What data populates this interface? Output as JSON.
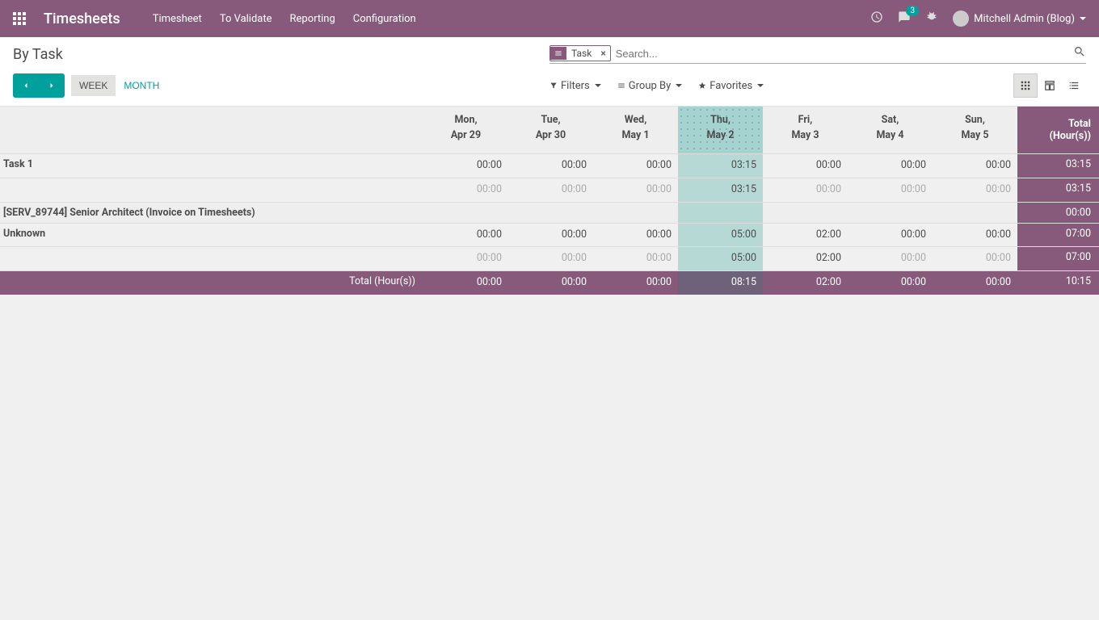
{
  "brand": "Timesheets",
  "nav": {
    "items": [
      "Timesheet",
      "To Validate",
      "Reporting",
      "Configuration"
    ],
    "chat_badge": "3",
    "user": "Mitchell Admin (Blog)"
  },
  "cp": {
    "title": "By Task",
    "facet": "Task",
    "search_placeholder": "Search...",
    "filters": "Filters",
    "groupby": "Group By",
    "favorites": "Favorites",
    "week": "WEEK",
    "month": "MONTH"
  },
  "grid": {
    "days": [
      {
        "d1": "Mon,",
        "d2": "Apr 29"
      },
      {
        "d1": "Tue,",
        "d2": "Apr 30"
      },
      {
        "d1": "Wed,",
        "d2": "May 1"
      },
      {
        "d1": "Thu,",
        "d2": "May 2"
      },
      {
        "d1": "Fri,",
        "d2": "May 3"
      },
      {
        "d1": "Sat,",
        "d2": "May 4"
      },
      {
        "d1": "Sun,",
        "d2": "May 5"
      }
    ],
    "total_label": "Total (Hour(s))",
    "rows": [
      {
        "label": "Task 1",
        "cells": [
          "00:00",
          "00:00",
          "00:00",
          "03:15",
          "00:00",
          "00:00",
          "00:00"
        ],
        "total": "03:15"
      },
      {
        "label": "",
        "sub": true,
        "cells": [
          "00:00",
          "00:00",
          "00:00",
          "03:15",
          "00:00",
          "00:00",
          "00:00"
        ],
        "dark": [
          3
        ],
        "total": "03:15"
      },
      {
        "label": "[SERV_89744] Senior Architect (Invoice on Timesheets)",
        "section": true,
        "cells": [
          "",
          "",
          "",
          "",
          "",
          "",
          ""
        ],
        "total": "00:00"
      },
      {
        "label": "Unknown",
        "cells": [
          "00:00",
          "00:00",
          "00:00",
          "05:00",
          "02:00",
          "00:00",
          "00:00"
        ],
        "total": "07:00"
      },
      {
        "label": "",
        "sub": true,
        "cells": [
          "00:00",
          "00:00",
          "00:00",
          "05:00",
          "02:00",
          "00:00",
          "00:00"
        ],
        "dark": [
          3,
          4
        ],
        "total": "07:00"
      }
    ],
    "footer": {
      "label": "Total (Hour(s))",
      "cells": [
        "00:00",
        "00:00",
        "00:00",
        "08:15",
        "02:00",
        "00:00",
        "00:00"
      ],
      "total": "10:15"
    }
  }
}
